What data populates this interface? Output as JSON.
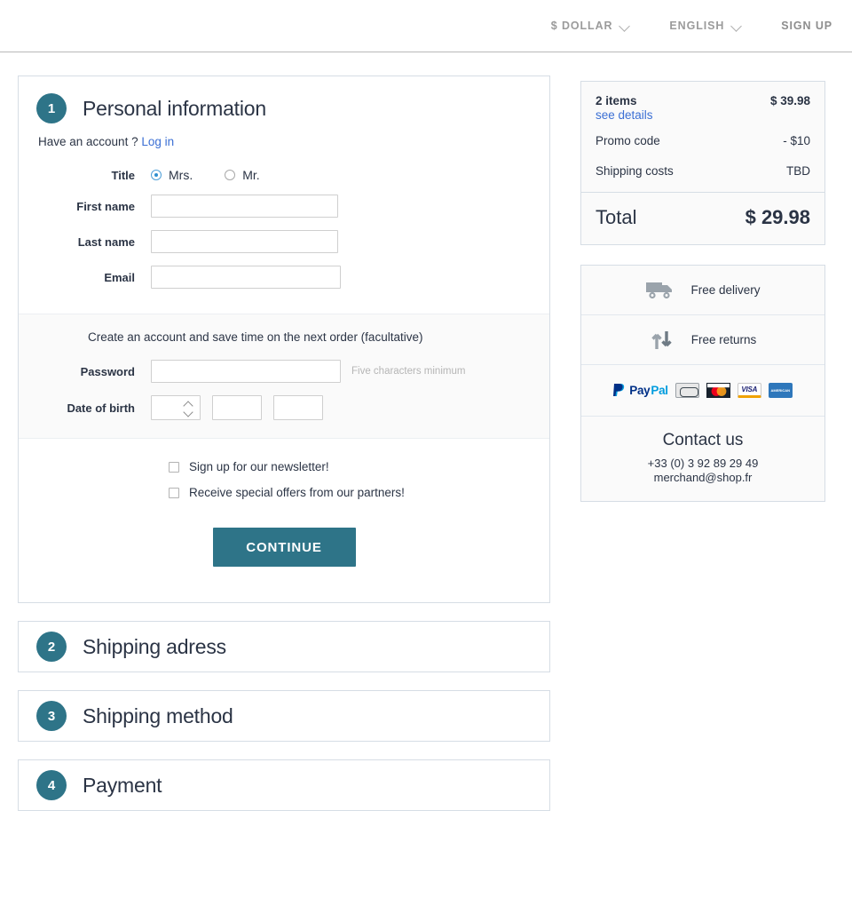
{
  "header": {
    "currency": "$ DOLLAR",
    "language": "ENGLISH",
    "signup": "SIGN UP"
  },
  "checkout": {
    "steps": [
      {
        "number": "1",
        "title": "Personal information"
      },
      {
        "number": "2",
        "title": "Shipping adress"
      },
      {
        "number": "3",
        "title": "Shipping method"
      },
      {
        "number": "4",
        "title": "Payment"
      }
    ],
    "have_account_text": "Have an account ?",
    "login_link": "Log in",
    "fields": {
      "title_label": "Title",
      "title_option_mrs": "Mrs.",
      "title_option_mr": "Mr.",
      "first_name_label": "First name",
      "first_name_value": "",
      "last_name_label": "Last name",
      "last_name_value": "",
      "email_label": "Email",
      "email_value": "",
      "password_label": "Password",
      "password_value": "",
      "password_hint": "Five characters minimum",
      "dob_label": "Date of birth",
      "dob_day_value": "",
      "dob_month_value": "",
      "dob_year_value": ""
    },
    "account_note": "Create an account and save time on the next order (facultative)",
    "checkboxes": [
      {
        "label": "Sign up for our newsletter!",
        "checked": false
      },
      {
        "label": "Receive special offers from our partners!",
        "checked": false
      }
    ],
    "continue_label": "CONTINUE"
  },
  "summary": {
    "items_label": "2 items",
    "items_amount": "$ 39.98",
    "see_details": "see details",
    "promo_label": "Promo code",
    "promo_amount": "- $10",
    "shipping_label": "Shipping costs",
    "shipping_amount": "TBD",
    "total_label": "Total",
    "total_amount": "$ 29.98"
  },
  "perks": {
    "free_delivery": "Free delivery",
    "free_returns": "Free returns",
    "payment_methods": [
      "PayPal",
      "CB",
      "MasterCard",
      "VISA",
      "American Express"
    ],
    "paypal_pay": "Pay",
    "paypal_pal": "Pal",
    "mastercard_text": "MasterCard",
    "visa_text": "VISA",
    "amex_line1": "AMERICAN",
    "amex_line2": "EXPRESS"
  },
  "contact": {
    "title": "Contact us",
    "phone": "+33 (0) 3 92 89 29 49",
    "email": "merchand@shop.fr"
  },
  "colors": {
    "accent_teal": "#2e7488",
    "link_blue": "#3b6fd4",
    "border_gray": "#d6dde5"
  }
}
